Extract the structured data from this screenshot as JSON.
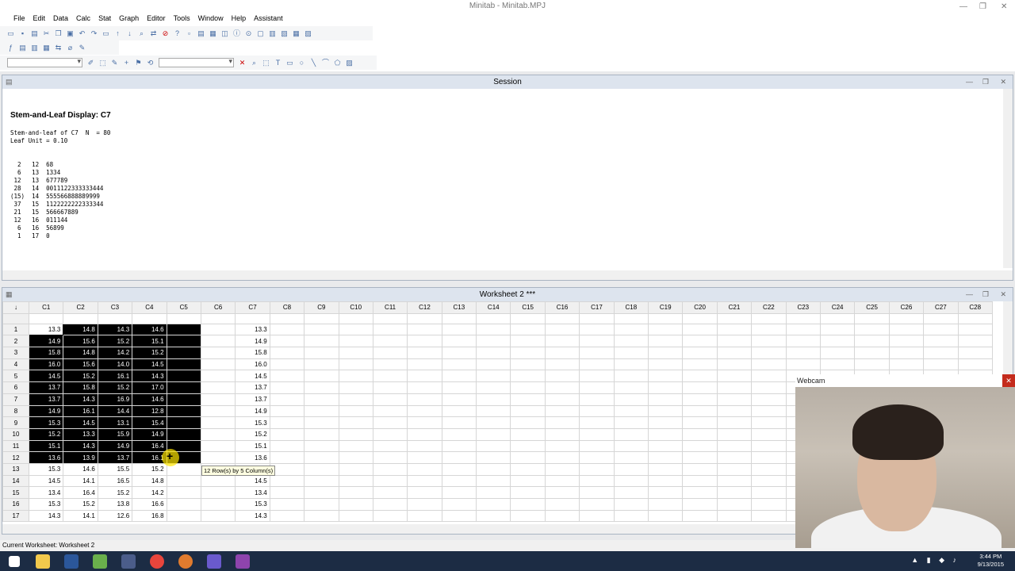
{
  "app": {
    "title": "Minitab - Minitab.MPJ",
    "window_controls": [
      "—",
      "❐",
      "✕"
    ]
  },
  "menu": [
    "File",
    "Edit",
    "Data",
    "Calc",
    "Stat",
    "Graph",
    "Editor",
    "Tools",
    "Window",
    "Help",
    "Assistant"
  ],
  "session": {
    "title": "Session",
    "heading": "Stem-and-Leaf Display: C7",
    "line1": "Stem-and-leaf of C7  N  = 80",
    "line2": "Leaf Unit = 0.10",
    "rows": [
      "  2   12  68",
      "  6   13  1334",
      " 12   13  677789",
      " 28   14  0011122333333444",
      "(15)  14  555566888889999",
      " 37   15  1122222222333344",
      " 21   15  566667889",
      " 12   16  011144",
      "  6   16  56899",
      "  1   17  0"
    ]
  },
  "worksheet": {
    "title": "Worksheet 2 ***",
    "corner": "↓",
    "columns": [
      "C1",
      "C2",
      "C3",
      "C4",
      "C5",
      "C6",
      "C7",
      "C8",
      "C9",
      "C10",
      "C11",
      "C12",
      "C13",
      "C14",
      "C15",
      "C16",
      "C17",
      "C18",
      "C19",
      "C20",
      "C21",
      "C22",
      "C23",
      "C24",
      "C25",
      "C26",
      "C27",
      "C28"
    ],
    "rows": [
      {
        "n": "1",
        "c1": "13.3",
        "c2": "14.8",
        "c3": "14.3",
        "c4": "14.6",
        "c7": "13.3"
      },
      {
        "n": "2",
        "c1": "14.9",
        "c2": "15.6",
        "c3": "15.2",
        "c4": "15.1",
        "c7": "14.9"
      },
      {
        "n": "3",
        "c1": "15.8",
        "c2": "14.8",
        "c3": "14.2",
        "c4": "15.2",
        "c7": "15.8"
      },
      {
        "n": "4",
        "c1": "16.0",
        "c2": "15.6",
        "c3": "14.0",
        "c4": "14.5",
        "c7": "16.0"
      },
      {
        "n": "5",
        "c1": "14.5",
        "c2": "15.2",
        "c3": "16.1",
        "c4": "14.3",
        "c7": "14.5"
      },
      {
        "n": "6",
        "c1": "13.7",
        "c2": "15.8",
        "c3": "15.2",
        "c4": "17.0",
        "c7": "13.7"
      },
      {
        "n": "7",
        "c1": "13.7",
        "c2": "14.3",
        "c3": "16.9",
        "c4": "14.6",
        "c7": "13.7"
      },
      {
        "n": "8",
        "c1": "14.9",
        "c2": "16.1",
        "c3": "14.4",
        "c4": "12.8",
        "c7": "14.9"
      },
      {
        "n": "9",
        "c1": "15.3",
        "c2": "14.5",
        "c3": "13.1",
        "c4": "15.4",
        "c7": "15.3"
      },
      {
        "n": "10",
        "c1": "15.2",
        "c2": "13.3",
        "c3": "15.9",
        "c4": "14.9",
        "c7": "15.2"
      },
      {
        "n": "11",
        "c1": "15.1",
        "c2": "14.3",
        "c3": "14.9",
        "c4": "16.4",
        "c7": "15.1"
      },
      {
        "n": "12",
        "c1": "13.6",
        "c2": "13.9",
        "c3": "13.7",
        "c4": "16.1",
        "c7": "13.6"
      },
      {
        "n": "13",
        "c1": "15.3",
        "c2": "14.6",
        "c3": "15.5",
        "c4": "15.2",
        "c7": "15.3"
      },
      {
        "n": "14",
        "c1": "14.5",
        "c2": "14.1",
        "c3": "16.5",
        "c4": "14.8",
        "c7": "14.5"
      },
      {
        "n": "15",
        "c1": "13.4",
        "c2": "16.4",
        "c3": "15.2",
        "c4": "14.2",
        "c7": "13.4"
      },
      {
        "n": "16",
        "c1": "15.3",
        "c2": "15.2",
        "c3": "13.8",
        "c4": "16.6",
        "c7": "15.3"
      },
      {
        "n": "17",
        "c1": "14.3",
        "c2": "14.1",
        "c3": "12.6",
        "c4": "16.8",
        "c7": "14.3"
      }
    ],
    "selected_rows": 12,
    "tooltip": "12 Row(s) by 5 Column(s)"
  },
  "status": "Current Worksheet: Worksheet 2",
  "webcam": {
    "title": "Webcam",
    "close": "✕"
  },
  "clock": {
    "time": "3:44 PM",
    "date": "9/13/2015"
  }
}
